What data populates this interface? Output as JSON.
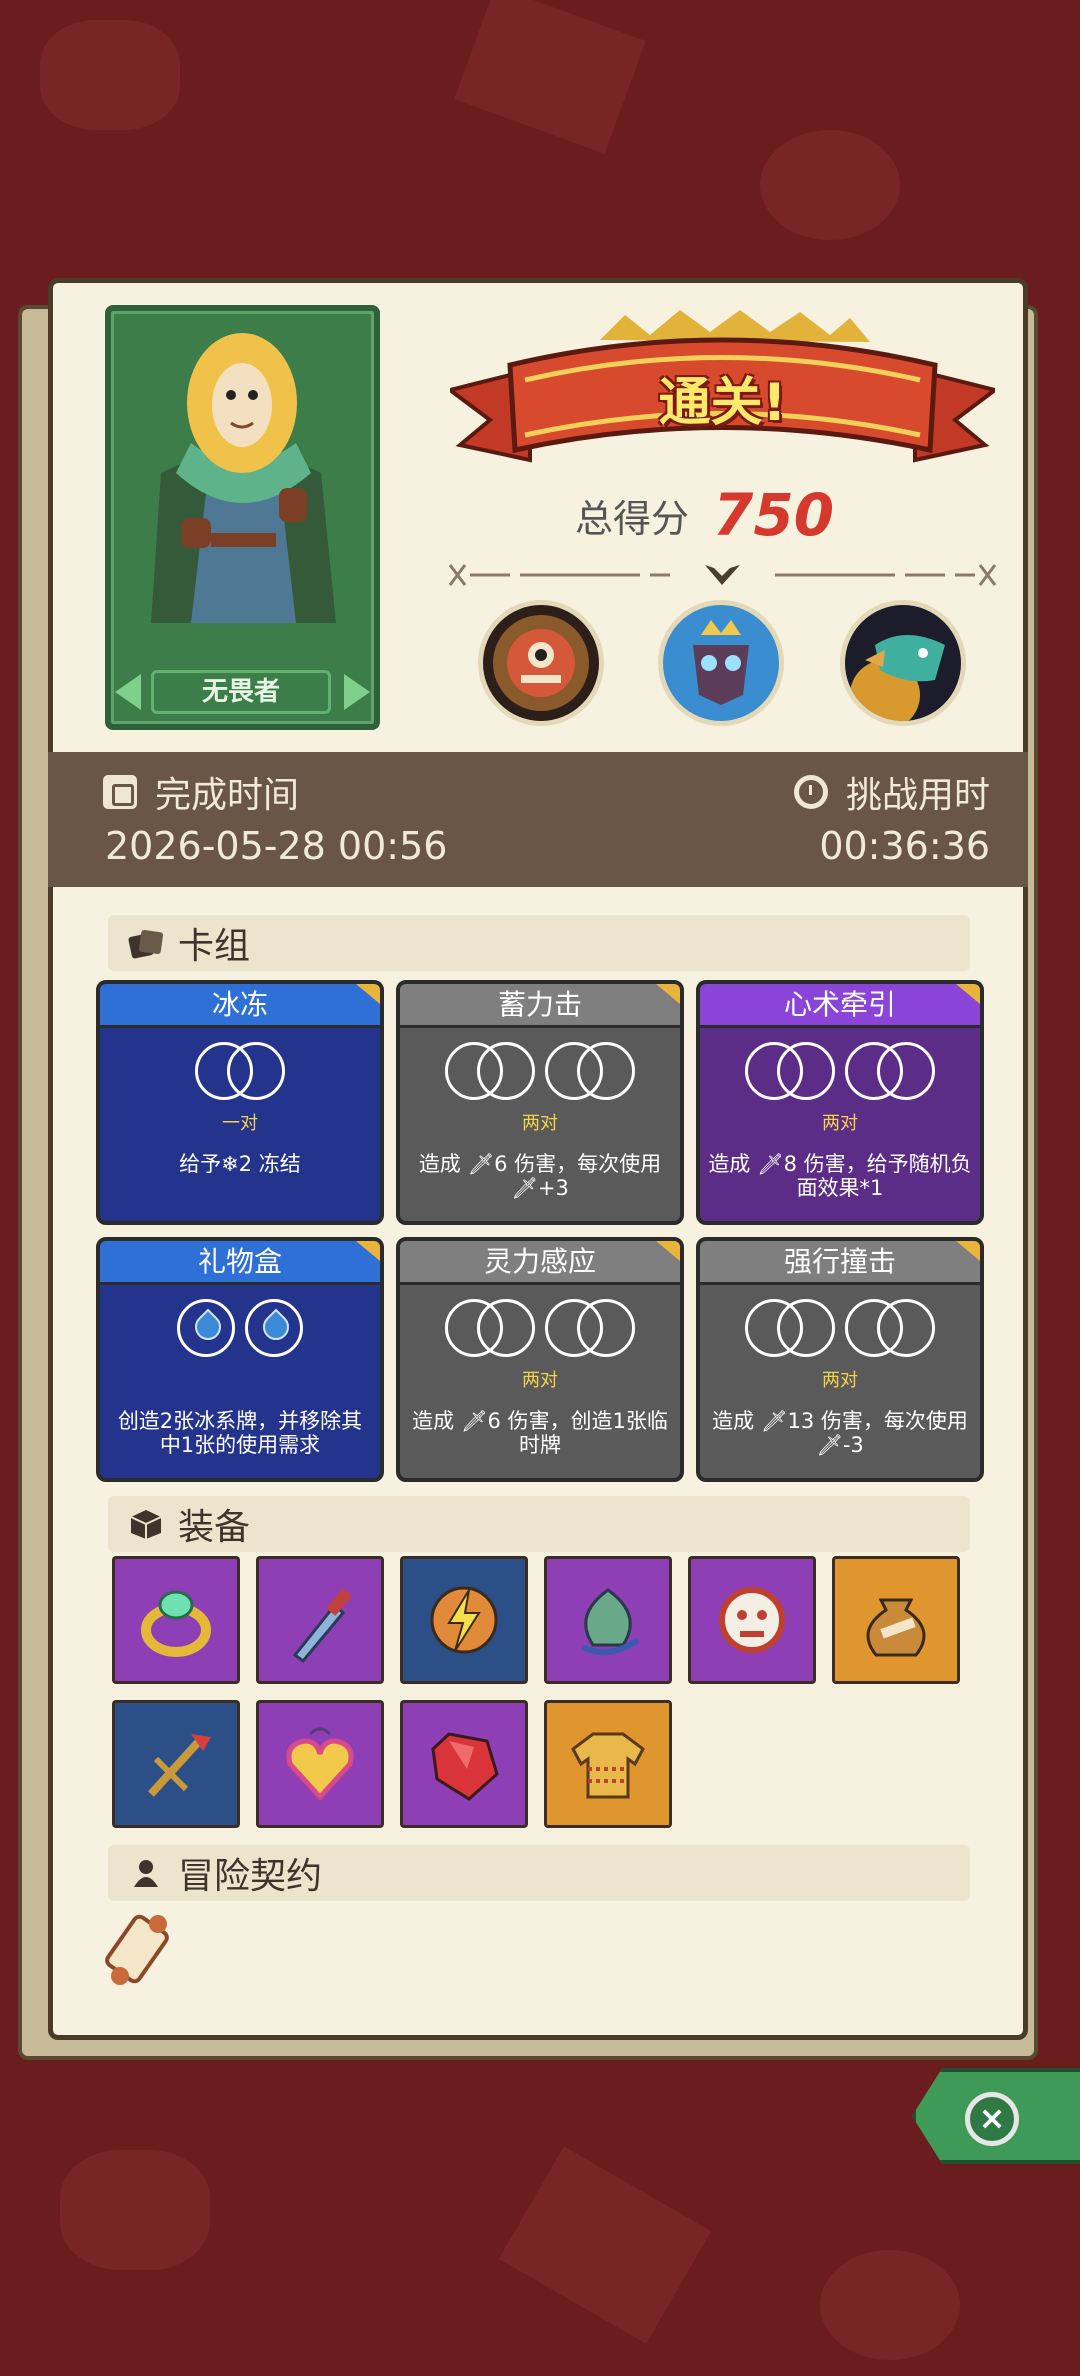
{
  "hero": {
    "name": "无畏者"
  },
  "result": {
    "banner": "通关!",
    "score_label": "总得分",
    "score_value": "750"
  },
  "time": {
    "finish_label": "完成时间",
    "finish_value": "2026-05-28 00:56",
    "duration_label": "挑战用时",
    "duration_value": "00:36:36"
  },
  "sections": {
    "deck": "卡组",
    "equipment": "装备",
    "contract": "冒险契约"
  },
  "cards": [
    {
      "title": "冰冻",
      "tag": "一对",
      "desc": "给予❄2 冻结",
      "style": "blue",
      "cost": "pair"
    },
    {
      "title": "蓄力击",
      "tag": "两对",
      "desc": "造成 🗡6 伤害，每次使用 🗡+3",
      "style": "gray",
      "cost": "two-pair"
    },
    {
      "title": "心术牵引",
      "tag": "两对",
      "desc": "造成 🗡8 伤害，给予随机负面效果*1",
      "style": "purple",
      "cost": "two-pair"
    },
    {
      "title": "礼物盒",
      "tag": "",
      "desc": "创造2张冰系牌，并移除其中1张的使用需求",
      "style": "blue",
      "cost": "drops"
    },
    {
      "title": "灵力感应",
      "tag": "两对",
      "desc": "造成 🗡6 伤害，创造1张临时牌",
      "style": "gray",
      "cost": "two-pair"
    },
    {
      "title": "强行撞击",
      "tag": "两对",
      "desc": "造成 🗡13 伤害，每次使用 🗡-3",
      "style": "gray",
      "cost": "two-pair"
    }
  ],
  "equipment": [
    {
      "icon": "ring-icon",
      "color": "#8e3fb5"
    },
    {
      "icon": "dagger-icon",
      "color": "#8e3fb5"
    },
    {
      "icon": "lightning-orb-icon",
      "color": "#2b4f86"
    },
    {
      "icon": "leaf-amulet-icon",
      "color": "#8e3fb5"
    },
    {
      "icon": "demon-mask-icon",
      "color": "#8e3fb5"
    },
    {
      "icon": "money-bag-icon",
      "color": "#e0962e"
    },
    {
      "icon": "crossbow-icon",
      "color": "#2b4f86"
    },
    {
      "icon": "heart-locket-icon",
      "color": "#8e3fb5"
    },
    {
      "icon": "ruby-icon",
      "color": "#8e3fb5"
    },
    {
      "icon": "sweater-icon",
      "color": "#e0962e"
    }
  ],
  "contracts": [
    {
      "icon": "scroll-icon"
    }
  ],
  "bosses": [
    "cyclops-boss-icon",
    "crowned-skull-boss-icon",
    "fish-boss-icon"
  ],
  "close": {
    "icon": "close-icon"
  }
}
